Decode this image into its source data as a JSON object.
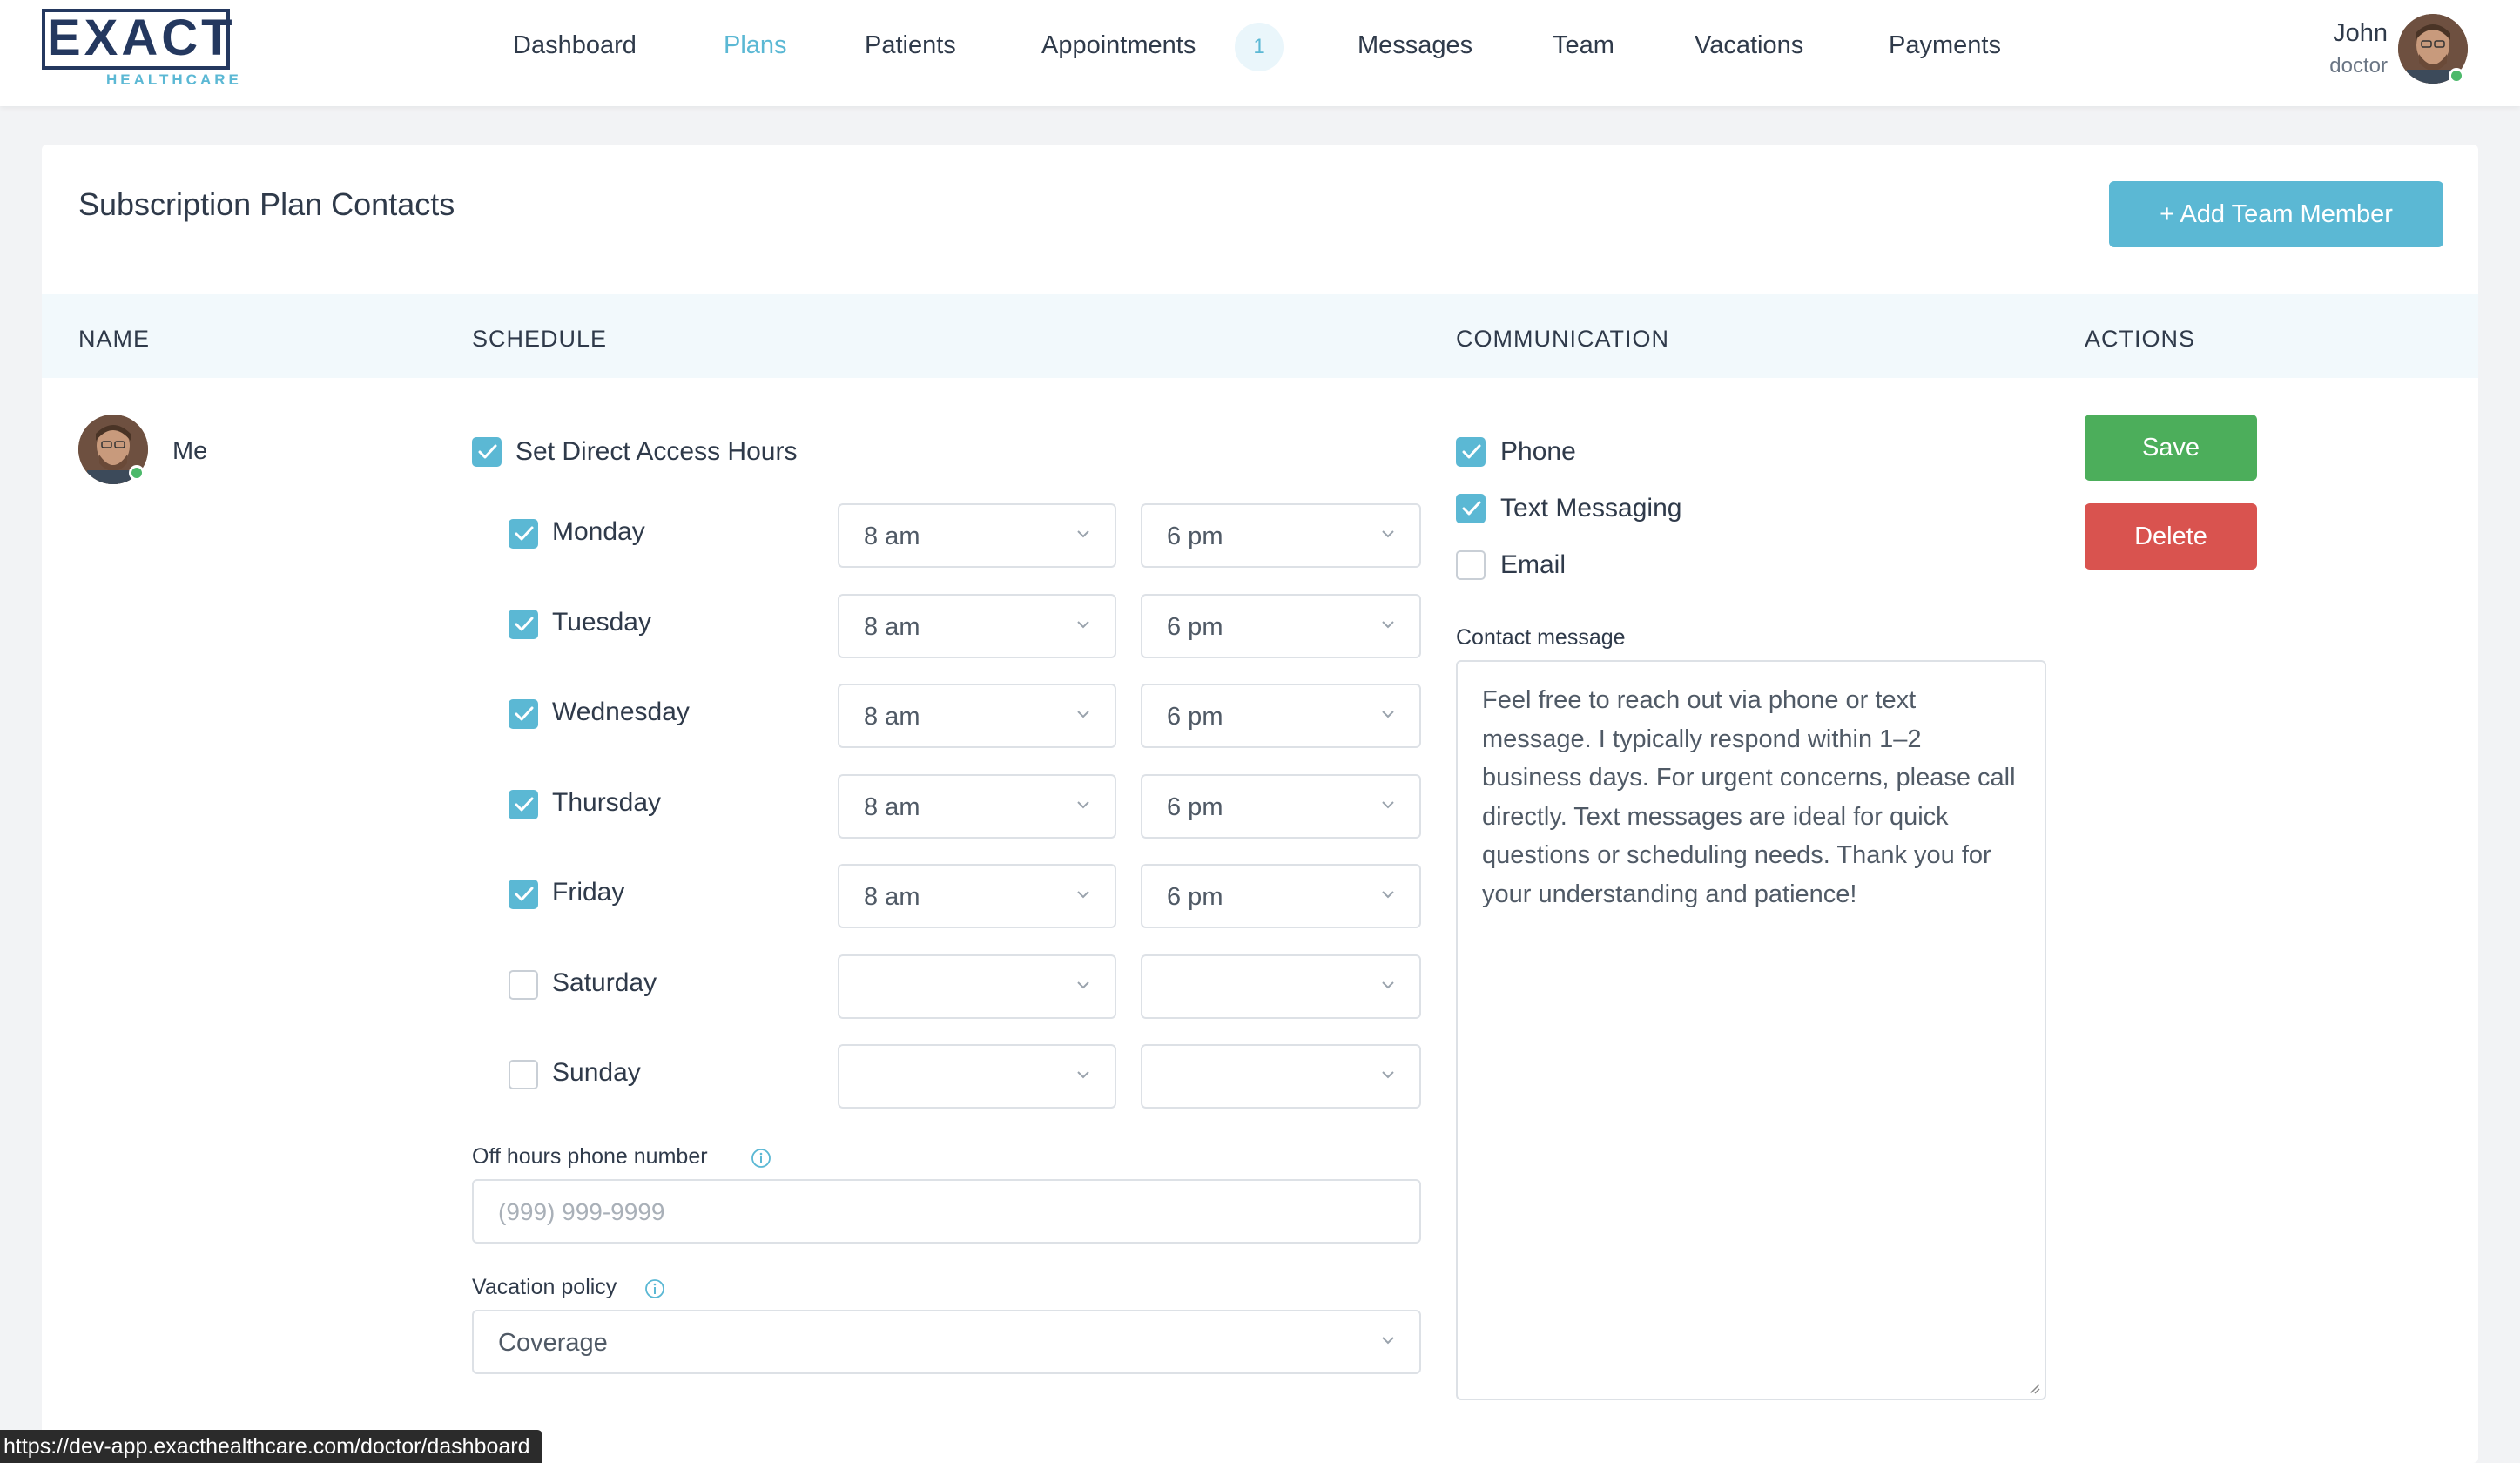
{
  "logo": {
    "word": "EXACT",
    "sub": "HEALTHCARE"
  },
  "nav": {
    "items": [
      {
        "label": "Dashboard"
      },
      {
        "label": "Plans"
      },
      {
        "label": "Patients"
      },
      {
        "label": "Appointments"
      },
      {
        "label": "Messages"
      },
      {
        "label": "Team"
      },
      {
        "label": "Vacations"
      },
      {
        "label": "Payments"
      }
    ],
    "active": "Plans",
    "appointments_badge": "1"
  },
  "user": {
    "name": "John",
    "role": "doctor",
    "online": true
  },
  "card": {
    "title": "Subscription Plan Contacts",
    "add_button": "+ Add Team Member"
  },
  "table": {
    "headers": {
      "name": "NAME",
      "schedule": "SCHEDULE",
      "communication": "COMMUNICATION",
      "actions": "ACTIONS"
    }
  },
  "row": {
    "name": "Me",
    "online": true,
    "direct_access": {
      "label": "Set Direct Access Hours",
      "checked": true
    },
    "days": [
      {
        "label": "Monday",
        "checked": true,
        "start": "8 am",
        "end": "6 pm"
      },
      {
        "label": "Tuesday",
        "checked": true,
        "start": "8 am",
        "end": "6 pm"
      },
      {
        "label": "Wednesday",
        "checked": true,
        "start": "8 am",
        "end": "6 pm"
      },
      {
        "label": "Thursday",
        "checked": true,
        "start": "8 am",
        "end": "6 pm"
      },
      {
        "label": "Friday",
        "checked": true,
        "start": "8 am",
        "end": "6 pm"
      },
      {
        "label": "Saturday",
        "checked": false,
        "start": "",
        "end": ""
      },
      {
        "label": "Sunday",
        "checked": false,
        "start": "",
        "end": ""
      }
    ],
    "off_hours": {
      "label": "Off hours phone number",
      "placeholder": "(999) 999-9999",
      "value": ""
    },
    "vacation_policy": {
      "label": "Vacation policy",
      "value": "Coverage"
    },
    "communication": [
      {
        "label": "Phone",
        "checked": true
      },
      {
        "label": "Text Messaging",
        "checked": true
      },
      {
        "label": "Email",
        "checked": false
      }
    ],
    "contact_message": {
      "label": "Contact message",
      "value": "Feel free to reach out via phone or text message. I typically respond within 1–2 business days. For urgent concerns, please call directly. Text messages are ideal for quick questions or scheduling needs. Thank you for your understanding and patience!"
    },
    "actions": {
      "save": "Save",
      "delete": "Delete"
    }
  },
  "status_bar": {
    "url": "https://dev-app.exacthealthcare.com/doctor/dashboard"
  },
  "colors": {
    "accent": "#5bb8d4",
    "navy": "#24385f",
    "save": "#4cae5b",
    "delete": "#d9534f",
    "online": "#4cb96b"
  }
}
